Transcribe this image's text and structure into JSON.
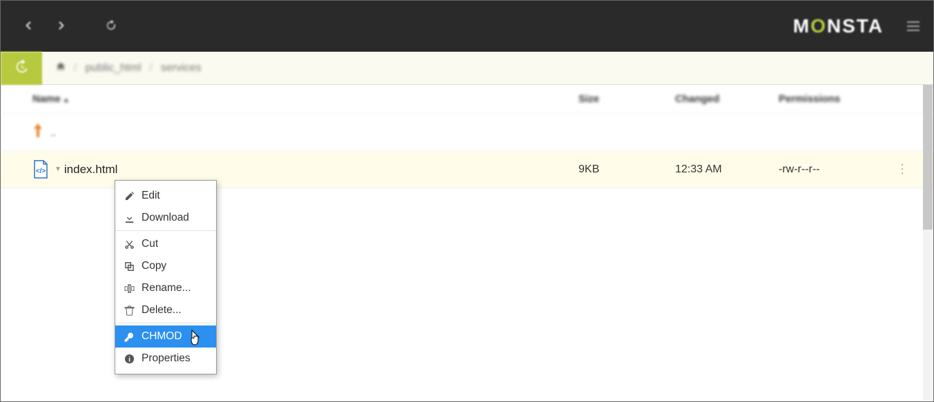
{
  "brand": {
    "text_pre": "M",
    "text_o": "O",
    "text_post": "NSTA"
  },
  "breadcrumb": {
    "seg1": "public_html",
    "seg2": "services"
  },
  "columns": {
    "name": "Name",
    "size": "Size",
    "changed": "Changed",
    "permissions": "Permissions"
  },
  "up_label": "..",
  "file": {
    "name": "index.html",
    "size": "9KB",
    "changed": "12:33 AM",
    "permissions": "-rw-r--r--"
  },
  "context_menu": {
    "edit": "Edit",
    "download": "Download",
    "cut": "Cut",
    "copy": "Copy",
    "rename": "Rename...",
    "delete": "Delete...",
    "chmod": "CHMOD",
    "properties": "Properties"
  }
}
